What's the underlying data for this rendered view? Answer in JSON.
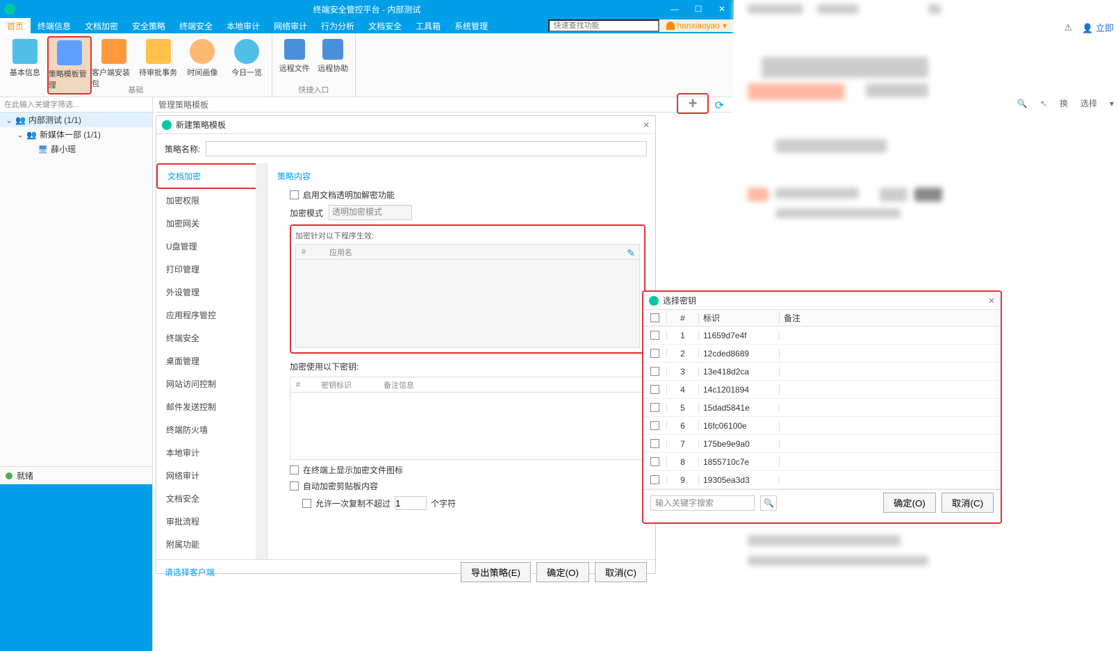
{
  "titlebar": {
    "title": "终端安全管控平台 - 内部测试"
  },
  "menu": {
    "tabs": [
      "首页",
      "终端信息",
      "文档加密",
      "安全策略",
      "终端安全",
      "本地审计",
      "网络审计",
      "行为分析",
      "文档安全",
      "工具箱",
      "系统管理"
    ],
    "search_placeholder": "快速查找功能",
    "user": "hanxiaoyao"
  },
  "ribbon": {
    "group1": {
      "label": "基础",
      "items": [
        "基本信息",
        "策略模板管理",
        "客户端安装包",
        "待审批事务",
        "时间画像",
        "今日一览"
      ]
    },
    "group2": {
      "label": "快捷入口",
      "items": [
        "远程文件",
        "远程协助"
      ]
    }
  },
  "tree": {
    "search": "在此输入关键字筛选...",
    "root": "内部测试 (1/1)",
    "child": "新媒体一部 (1/1)",
    "leaf": "薛小瑶",
    "status": "就绪"
  },
  "content": {
    "header": "管理策略模板"
  },
  "dialog": {
    "title": "新建策略模板",
    "name_label": "策略名称:",
    "section": "策略内容",
    "chk_enable": "启用文档透明加解密功能",
    "mode_label": "加密模式",
    "mode_value": "透明加密模式",
    "process_label": "加密针对以下程序生效:",
    "pt_col1": "#",
    "pt_col2": "应用名",
    "key_label": "加密使用以下密钥:",
    "kt_col1": "#",
    "kt_col2": "密钥标识",
    "kt_col3": "备注信息",
    "chk_icon": "在终端上显示加密文件图标",
    "chk_clip": "自动加密剪贴板内容",
    "chk_copy": "允许一次复制不超过",
    "copy_unit": "个字符",
    "copy_val": "1",
    "side": [
      "文档加密",
      "加密权限",
      "加密网关",
      "U盘管理",
      "打印管理",
      "外设管理",
      "应用程序管控",
      "终端安全",
      "桌面管理",
      "网站访问控制",
      "邮件发送控制",
      "终端防火墙",
      "本地审计",
      "网络审计",
      "文档安全",
      "审批流程",
      "附属功能"
    ],
    "footer_link": "请选择客户端",
    "btn_export": "导出策略(E)",
    "btn_ok": "确定(O)",
    "btn_cancel": "取消(C)"
  },
  "keydlg": {
    "title": "选择密钥",
    "h_num": "#",
    "h_id": "标识",
    "h_note": "备注",
    "rows": [
      {
        "n": "1",
        "id": "11659d7e4f"
      },
      {
        "n": "2",
        "id": "12cded8689"
      },
      {
        "n": "3",
        "id": "13e418d2ca"
      },
      {
        "n": "4",
        "id": "14c1201894"
      },
      {
        "n": "5",
        "id": "15dad5841e"
      },
      {
        "n": "6",
        "id": "16fc06100e"
      },
      {
        "n": "7",
        "id": "175be9e9a0"
      },
      {
        "n": "8",
        "id": "1855710c7e"
      },
      {
        "n": "9",
        "id": "19305ea3d3"
      }
    ],
    "search_ph": "输入关键字搜索",
    "btn_ok": "确定(O)",
    "btn_cancel": "取消(C)"
  },
  "rightpanel": {
    "btn_login": "立即",
    "btn_switch": "换",
    "btn_select": "选择"
  }
}
